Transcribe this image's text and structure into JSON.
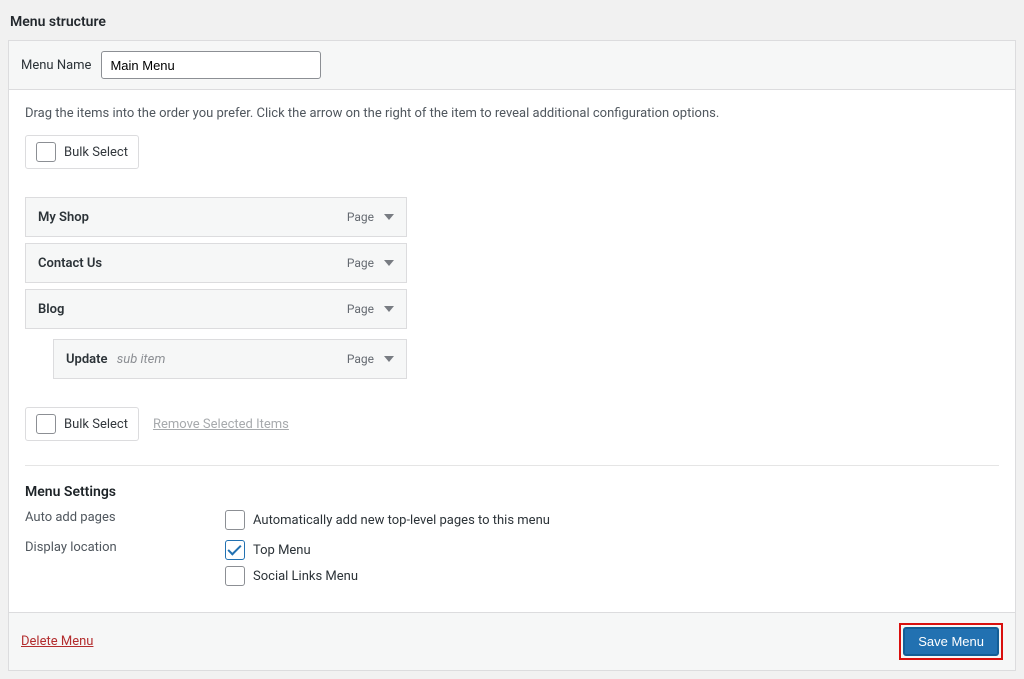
{
  "page_title": "Menu structure",
  "menu_name": {
    "label": "Menu Name",
    "value": "Main Menu"
  },
  "instructions": "Drag the items into the order you prefer. Click the arrow on the right of the item to reveal additional configuration options.",
  "bulk_select_label": "Bulk Select",
  "remove_selected_label": "Remove Selected Items",
  "type_label_page": "Page",
  "sub_item_label": "sub item",
  "menu_items": [
    {
      "label": "My Shop",
      "type": "Page",
      "depth": 0
    },
    {
      "label": "Contact Us",
      "type": "Page",
      "depth": 0
    },
    {
      "label": "Blog",
      "type": "Page",
      "depth": 0
    },
    {
      "label": "Update",
      "type": "Page",
      "depth": 1
    }
  ],
  "settings_title": "Menu Settings",
  "settings": {
    "auto_add": {
      "label": "Auto add pages",
      "option": "Automatically add new top-level pages to this menu",
      "checked": false
    },
    "display_location": {
      "label": "Display location",
      "options": [
        {
          "label": "Top Menu",
          "checked": true
        },
        {
          "label": "Social Links Menu",
          "checked": false
        }
      ]
    }
  },
  "footer": {
    "delete_label": "Delete Menu",
    "save_label": "Save Menu"
  }
}
